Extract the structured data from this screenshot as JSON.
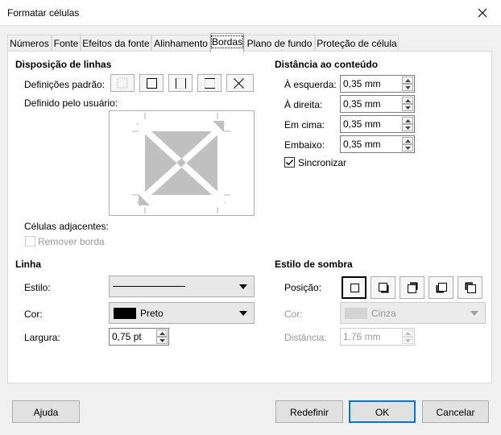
{
  "window": {
    "title": "Formatar células"
  },
  "tabs": [
    {
      "label": "Números",
      "active": false
    },
    {
      "label": "Fonte",
      "active": false
    },
    {
      "label": "Efeitos da fonte",
      "active": false
    },
    {
      "label": "Alinhamento",
      "active": false
    },
    {
      "label": "Bordas",
      "active": true
    },
    {
      "label": "Plano de fundo",
      "active": false
    },
    {
      "label": "Proteção de célula",
      "active": false
    }
  ],
  "line_arrangement": {
    "title": "Disposição de linhas",
    "presets_label": "Definições padrão:",
    "user_defined_label": "Definido pelo usuário:",
    "adjacent_label": "Células adjacentes:",
    "remove_border_label": "Remover borda",
    "remove_border_checked": false
  },
  "padding": {
    "title": "Distância ao conteúdo",
    "left_label": "À esquerda:",
    "left_value": "0,35 mm",
    "right_label": "À direita:",
    "right_value": "0,35 mm",
    "top_label": "Em cima:",
    "top_value": "0,35 mm",
    "bottom_label": "Embaixo:",
    "bottom_value": "0,35 mm",
    "sync_label": "Sincronizar",
    "sync_checked": true
  },
  "line": {
    "title": "Linha",
    "style_label": "Estilo:",
    "color_label": "Cor:",
    "color_value": "Preto",
    "color_swatch": "#000000",
    "width_label": "Largura:",
    "width_value": "0,75 pt"
  },
  "shadow": {
    "title": "Estilo de sombra",
    "position_label": "Posição:",
    "color_label": "Cor:",
    "color_value": "Cinza",
    "color_swatch": "#c0c0c0",
    "distance_label": "Distância:",
    "distance_value": "1,76 mm"
  },
  "buttons": {
    "help": "Ajuda",
    "reset": "Redefinir",
    "ok": "OK",
    "cancel": "Cancelar"
  }
}
